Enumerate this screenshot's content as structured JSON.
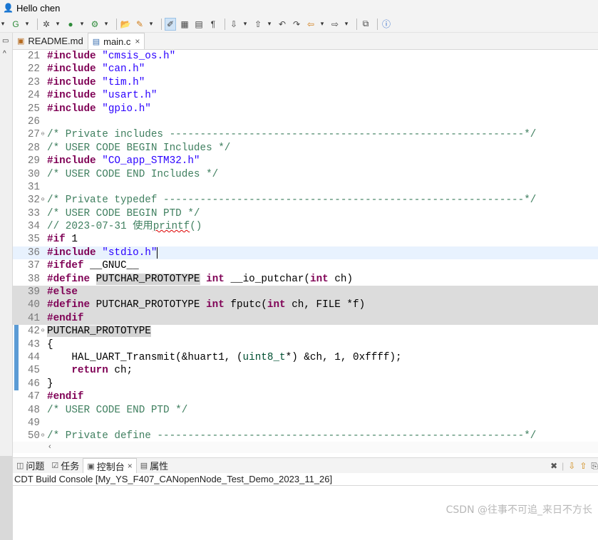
{
  "titlebar": {
    "greeting": "Hello chen"
  },
  "editor_tabs": [
    {
      "label": "README.md",
      "icon": "markdown-file-icon",
      "active": false
    },
    {
      "label": "main.c",
      "icon": "c-file-icon",
      "active": true
    }
  ],
  "code_lines": [
    {
      "num": "21",
      "text": "#include \"cmsis_os.h\""
    },
    {
      "num": "22",
      "text": "#include \"can.h\""
    },
    {
      "num": "23",
      "text": "#include \"tim.h\""
    },
    {
      "num": "24",
      "text": "#include \"usart.h\""
    },
    {
      "num": "25",
      "text": "#include \"gpio.h\""
    },
    {
      "num": "26",
      "text": ""
    },
    {
      "num": "27",
      "text": "/* Private includes ----------------------------------------------------------*/"
    },
    {
      "num": "28",
      "text": "/* USER CODE BEGIN Includes */"
    },
    {
      "num": "29",
      "text": "#include \"CO_app_STM32.h\""
    },
    {
      "num": "30",
      "text": "/* USER CODE END Includes */"
    },
    {
      "num": "31",
      "text": ""
    },
    {
      "num": "32",
      "text": "/* Private typedef -----------------------------------------------------------*/"
    },
    {
      "num": "33",
      "text": "/* USER CODE BEGIN PTD */"
    },
    {
      "num": "34",
      "text": "// 2023-07-31 使用printf()"
    },
    {
      "num": "35",
      "text": "#if 1"
    },
    {
      "num": "36",
      "text": "#include \"stdio.h\""
    },
    {
      "num": "37",
      "text": "#ifdef __GNUC__"
    },
    {
      "num": "38",
      "text": "#define PUTCHAR_PROTOTYPE int __io_putchar(int ch)"
    },
    {
      "num": "39",
      "text": "#else"
    },
    {
      "num": "40",
      "text": "#define PUTCHAR_PROTOTYPE int fputc(int ch, FILE *f)"
    },
    {
      "num": "41",
      "text": "#endif"
    },
    {
      "num": "42",
      "text": "PUTCHAR_PROTOTYPE"
    },
    {
      "num": "43",
      "text": "{"
    },
    {
      "num": "44",
      "text": "    HAL_UART_Transmit(&huart1, (uint8_t*) &ch, 1, 0xffff);"
    },
    {
      "num": "45",
      "text": "    return ch;"
    },
    {
      "num": "46",
      "text": "}"
    },
    {
      "num": "47",
      "text": "#endif"
    },
    {
      "num": "48",
      "text": "/* USER CODE END PTD */"
    },
    {
      "num": "49",
      "text": ""
    },
    {
      "num": "50",
      "text": "/* Private define ------------------------------------------------------------*/"
    }
  ],
  "console": {
    "tabs": [
      {
        "label": "问题",
        "icon": "problems-icon",
        "active": false
      },
      {
        "label": "任务",
        "icon": "tasks-icon",
        "active": false
      },
      {
        "label": "控制台",
        "icon": "console-icon",
        "active": true
      },
      {
        "label": "属性",
        "icon": "properties-icon",
        "active": false
      }
    ],
    "title": "CDT Build Console [My_YS_F407_CANopenNode_Test_Demo_2023_11_26]"
  },
  "watermark": "CSDN @往事不可追_来日不方长",
  "colors": {
    "keyword": "#7f0055",
    "string": "#2a00ff",
    "comment": "#3f7f5f",
    "current_line": "#e8f2fe",
    "inactive_block": "#dcdcdc",
    "modified_marker": "#5b9bd5"
  }
}
